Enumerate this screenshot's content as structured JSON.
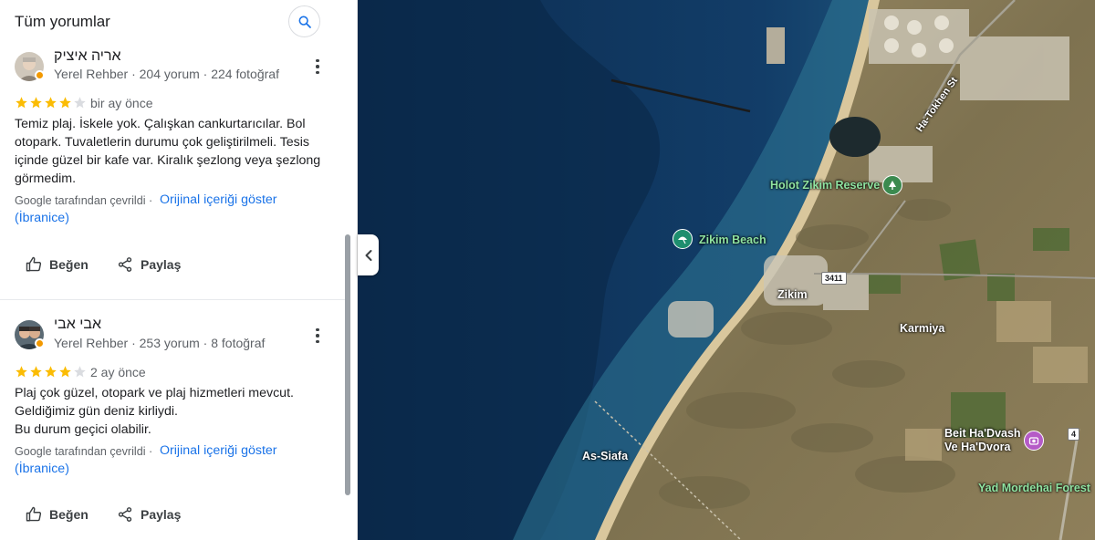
{
  "panel": {
    "title": "Tüm yorumlar",
    "search_icon": "search-icon"
  },
  "reviews": [
    {
      "author": "אריה איציק",
      "meta": "Yerel Rehber · 204 yorum · 224 fotoğraf",
      "rating": 4,
      "when": "bir ay önce",
      "text": "Temiz plaj. İskele yok. Çalışkan cankurtarıcılar. Bol otopark. Tuvaletlerin durumu çok geliştirilmeli. Tesis içinde güzel bir kafe var. Kiralık şezlong veya şezlong görmedim.",
      "translated": "Google tarafından çevrildi  ·",
      "original_link": "Orijinal içeriği göster",
      "original_lang": "(İbranice)",
      "like": "Beğen",
      "share": "Paylaş"
    },
    {
      "author": "אבי אבי",
      "meta": "Yerel Rehber · 253 yorum · 8 fotoğraf",
      "rating": 4,
      "when": "2 ay önce",
      "text_lines": [
        "Plaj çok güzel, otopark ve plaj hizmetleri mevcut.",
        "Geldiğimiz gün deniz kirliydi.",
        "Bu durum geçici olabilir."
      ],
      "translated": "Google tarafından çevrildi  ·",
      "original_link": "Orijinal içeriği göster",
      "original_lang": "(İbranice)",
      "like": "Beğen",
      "share": "Paylaş"
    }
  ],
  "map": {
    "labels": {
      "holot": "Holot Zikim Reserve",
      "zikim_beach": "Zikim Beach",
      "zikim": "Zikim",
      "karmiya": "Karmiya",
      "beit": "Beit Ha'Dvash",
      "beit2": "Ve Ha'Dvora",
      "yad": "Yad Mordehai Forest",
      "as_siafa": "As-Siafa",
      "ha_tokhen": "Ha-Tokhen St",
      "road_3411": "3411",
      "road_4": "4"
    },
    "colors": {
      "sea_deep": "#0d2f55",
      "sea_shallow": "#2a6d8f",
      "land": "#8a7a58",
      "beach": "#d7c49a",
      "star": "#fbbc04",
      "star_empty": "#dadce0",
      "link": "#1a73e8"
    }
  }
}
